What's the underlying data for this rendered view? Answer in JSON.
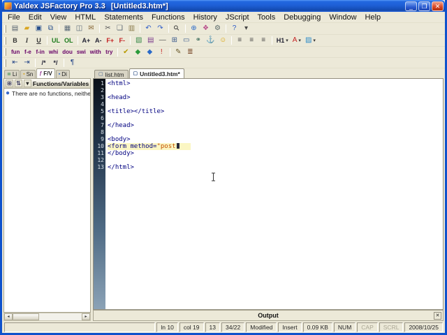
{
  "window": {
    "title": "Yaldex JSFactory Pro 3.3",
    "document_title": "[Untitled3.htm*]",
    "controls": {
      "minimize": "_",
      "maximize": "❐",
      "close": "✕"
    }
  },
  "menubar": {
    "items": [
      "File",
      "Edit",
      "View",
      "HTML",
      "Statements",
      "Functions",
      "History",
      "JScript",
      "Tools",
      "Debugging",
      "Window",
      "Help"
    ]
  },
  "toolbars": {
    "standard": [
      {
        "name": "new",
        "icon": "page"
      },
      {
        "name": "open",
        "icon": "folder"
      },
      {
        "name": "save",
        "icon": "floppy"
      },
      {
        "name": "save-all",
        "icon": "floppies"
      },
      {
        "sep": true
      },
      {
        "name": "print",
        "icon": "printer"
      },
      {
        "name": "print-preview",
        "icon": "preview"
      },
      {
        "name": "mail",
        "icon": "mail"
      },
      {
        "sep": true
      },
      {
        "name": "cut",
        "icon": "cut"
      },
      {
        "name": "copy",
        "icon": "copy"
      },
      {
        "name": "paste",
        "icon": "paste"
      },
      {
        "sep": true
      },
      {
        "name": "undo",
        "icon": "undo"
      },
      {
        "name": "redo",
        "icon": "redo"
      },
      {
        "sep": true
      },
      {
        "name": "find",
        "icon": "find"
      },
      {
        "sep": true
      },
      {
        "name": "browser-preview",
        "icon": "globe"
      },
      {
        "name": "color-picker",
        "icon": "palette"
      },
      {
        "name": "options",
        "icon": "gear"
      },
      {
        "sep": true
      },
      {
        "name": "help",
        "icon": "help"
      },
      {
        "name": "view-menu",
        "icon": "zoom"
      }
    ],
    "format": [
      {
        "name": "bold",
        "label": "B",
        "style": "bold"
      },
      {
        "name": "italic",
        "label": "I",
        "style": "italic"
      },
      {
        "name": "underline",
        "label": "U",
        "style": "underline"
      },
      {
        "sep": true
      },
      {
        "name": "unordered-list",
        "label": "UL",
        "style": "green"
      },
      {
        "name": "ordered-list",
        "label": "OL",
        "style": "green"
      },
      {
        "sep": true
      },
      {
        "name": "anchor-plus",
        "label": "A+",
        "style": "dark"
      },
      {
        "name": "anchor-minus",
        "label": "A-",
        "style": "dark"
      },
      {
        "name": "font-increase",
        "label": "F+",
        "style": "red"
      },
      {
        "name": "font-decrease",
        "label": "F-",
        "style": "red"
      },
      {
        "sep": true
      },
      {
        "name": "insert-image",
        "icon": "image"
      },
      {
        "name": "insert-film",
        "icon": "film"
      },
      {
        "name": "insert-rule",
        "icon": "hr"
      },
      {
        "name": "insert-table",
        "icon": "table"
      },
      {
        "name": "insert-form",
        "icon": "form"
      },
      {
        "name": "insert-link",
        "icon": "link"
      },
      {
        "name": "insert-anchor",
        "icon": "anchor"
      },
      {
        "name": "insert-smiley",
        "icon": "smiley"
      },
      {
        "sep": true
      },
      {
        "name": "align-left",
        "icon": "align-left"
      },
      {
        "name": "align-center",
        "icon": "align-center"
      },
      {
        "name": "align-right",
        "icon": "align-right"
      },
      {
        "sep": true
      },
      {
        "name": "heading",
        "label": "H1",
        "style": "dark",
        "dropdown": true
      },
      {
        "name": "font-color",
        "icon": "font-color",
        "dropdown": true
      },
      {
        "name": "fill-color",
        "icon": "fill-color",
        "dropdown": true
      }
    ],
    "script": [
      {
        "name": "function-statement",
        "label": "fun",
        "style": "script"
      },
      {
        "name": "for-each-statement",
        "label": "f-e",
        "style": "script"
      },
      {
        "name": "for-in-statement",
        "label": "f-in",
        "style": "script"
      },
      {
        "name": "while-statement",
        "label": "whi",
        "style": "script"
      },
      {
        "name": "do-while-statement",
        "label": "dou",
        "style": "script"
      },
      {
        "name": "switch-statement",
        "label": "swi",
        "style": "script"
      },
      {
        "name": "with-statement",
        "label": "with",
        "style": "script"
      },
      {
        "name": "try-statement",
        "label": "try",
        "style": "script"
      },
      {
        "sep": true
      },
      {
        "name": "syntax-check",
        "icon": "check"
      },
      {
        "name": "run-script",
        "icon": "diamond-green"
      },
      {
        "name": "debug-script",
        "icon": "diamond-blue"
      },
      {
        "name": "error-list",
        "icon": "warning"
      },
      {
        "sep": true
      },
      {
        "name": "edit-snippet",
        "icon": "pencil"
      },
      {
        "name": "reference",
        "icon": "book"
      }
    ],
    "edit": [
      {
        "name": "indent-decrease",
        "icon": "indent-left"
      },
      {
        "name": "indent-increase",
        "icon": "indent-right"
      },
      {
        "sep": true
      },
      {
        "name": "comment-selection",
        "label": "/*",
        "style": "dark"
      },
      {
        "name": "uncomment-selection",
        "label": "*/",
        "style": "dark"
      },
      {
        "sep": true
      },
      {
        "name": "special-characters",
        "icon": "pilcrow"
      }
    ]
  },
  "sidebar": {
    "tabs": [
      {
        "label": "Li",
        "icon": "tab-li"
      },
      {
        "label": "Sn",
        "icon": "tab-sn"
      },
      {
        "label": "F/V",
        "icon": "tab-fv",
        "active": true
      },
      {
        "label": "Di",
        "icon": "tab-di"
      }
    ],
    "panel_title": "Functions/Variables",
    "empty_message": "There are no functions, neither var"
  },
  "editor": {
    "tabs": [
      {
        "label": "list.htm",
        "icon": "doc"
      },
      {
        "label": "Untitled3.htm*",
        "icon": "doc",
        "active": true
      }
    ],
    "syntax_colors": {
      "tag": "#000080",
      "string": "#c45000",
      "current_line_bg": "#fbf6c3"
    },
    "current_line": 10,
    "lines": [
      {
        "n": "1",
        "segs": [
          {
            "t": "<html>",
            "c": "tag"
          }
        ]
      },
      {
        "n": "2",
        "segs": []
      },
      {
        "n": "3",
        "segs": [
          {
            "t": "<head>",
            "c": "tag"
          }
        ]
      },
      {
        "n": "4",
        "segs": []
      },
      {
        "n": "5",
        "segs": [
          {
            "t": "<title></title>",
            "c": "tag"
          }
        ]
      },
      {
        "n": "6",
        "segs": []
      },
      {
        "n": "7",
        "segs": [
          {
            "t": "</head>",
            "c": "tag"
          }
        ]
      },
      {
        "n": "8",
        "segs": []
      },
      {
        "n": "9",
        "segs": [
          {
            "t": "<body>",
            "c": "tag"
          }
        ]
      },
      {
        "n": "10",
        "current": true,
        "segs": [
          {
            "t": "<form method=",
            "c": "tag"
          },
          {
            "t": "\"post",
            "c": "string"
          },
          {
            "caret": true
          }
        ]
      },
      {
        "n": "11",
        "segs": [
          {
            "t": "</body>",
            "c": "tag"
          }
        ]
      },
      {
        "n": "12",
        "segs": []
      },
      {
        "n": "13",
        "segs": [
          {
            "t": "</html>",
            "c": "tag"
          }
        ]
      }
    ]
  },
  "output": {
    "title": "Output",
    "close": "✕"
  },
  "statusbar": {
    "fields": [
      {
        "key": "message",
        "text": "",
        "grow": true
      },
      {
        "key": "line",
        "text": "ln 10"
      },
      {
        "key": "column",
        "text": "col 19"
      },
      {
        "key": "total-lines",
        "text": "13"
      },
      {
        "key": "position",
        "text": "34/22"
      },
      {
        "key": "modified",
        "text": "Modified"
      },
      {
        "key": "insert-mode",
        "text": "Insert"
      },
      {
        "key": "file-size",
        "text": "0.09 KB"
      },
      {
        "key": "num-lock",
        "text": "NUM"
      },
      {
        "key": "caps-lock",
        "text": "CAP",
        "dim": true
      },
      {
        "key": "scroll-lock",
        "text": "SCRL",
        "dim": true
      },
      {
        "key": "date",
        "text": "2008/10/25"
      }
    ]
  }
}
